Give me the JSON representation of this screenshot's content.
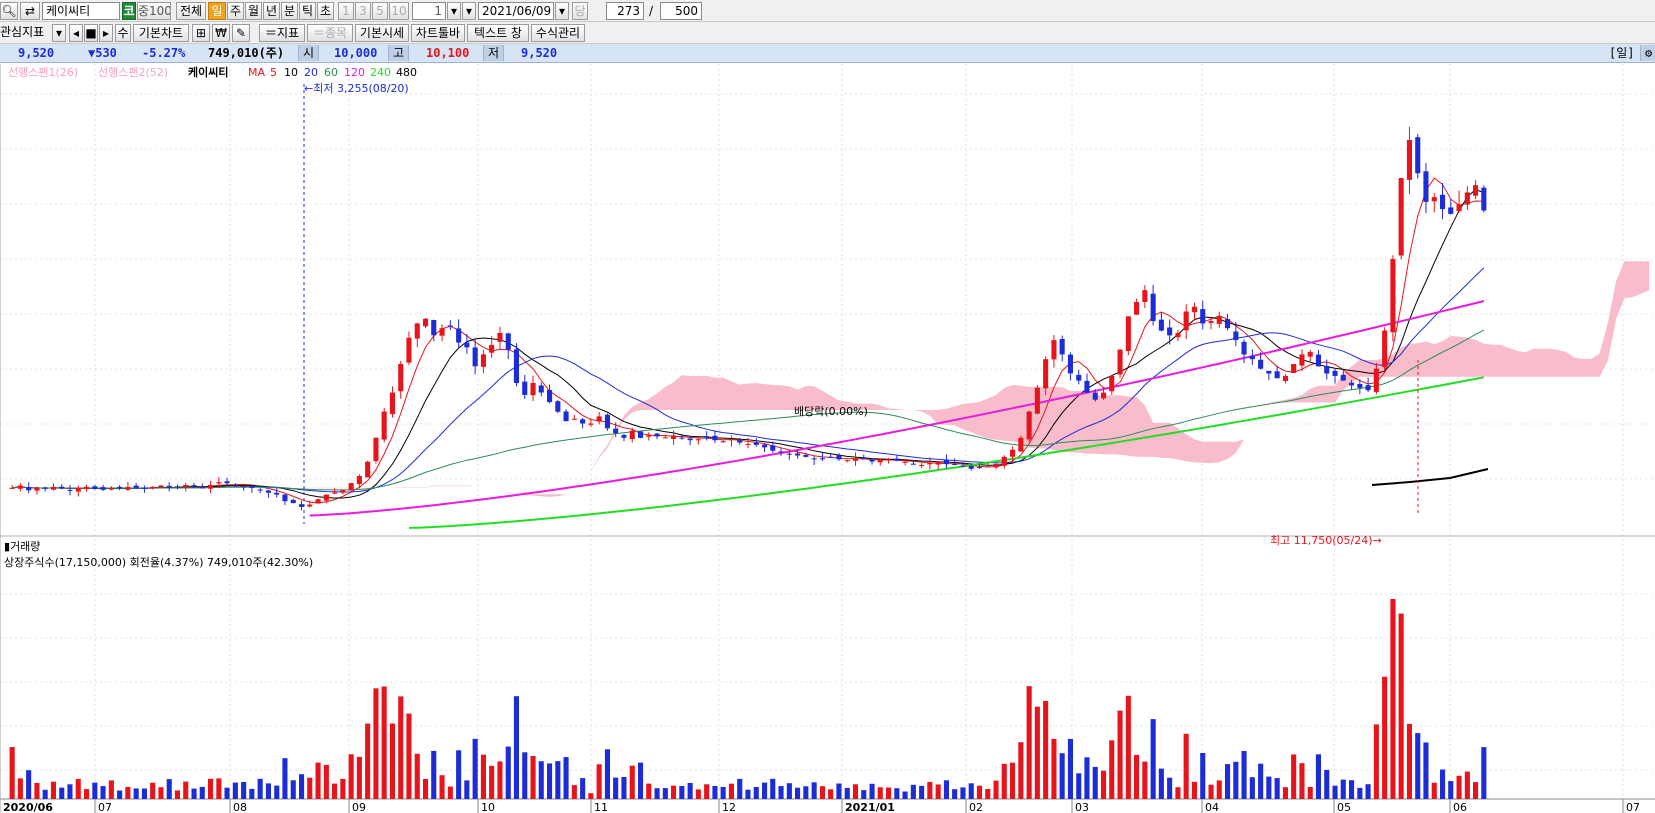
{
  "toolbar1": {
    "stock_name": "케이씨티",
    "market_badge": "코",
    "index_badge": "중100",
    "period_all": "전체",
    "period_day": "일",
    "period_week": "주",
    "period_month": "월",
    "period_year": "년",
    "period_minute": "분",
    "period_tick": "틱",
    "period_second": "초",
    "interval_1": "1",
    "interval_3": "3",
    "interval_5": "5",
    "interval_10": "10",
    "interval_value": "1",
    "date": "2021/06/09",
    "date_suffix": "당",
    "count": "273",
    "slash": "/",
    "total": "500"
  },
  "toolbar2": {
    "interest_indicator": "관심지표",
    "basic_chart": "기본차트",
    "plus_indicator": "＝지표",
    "plus_stock": "＝종목",
    "basic_quote": "기본시세",
    "chart_toolbar": "차트툴바",
    "text_toggle": "텍스트 창",
    "formula_manage": "수식관리",
    "won_icon": "₩",
    "sum_label": "수"
  },
  "pricebar": {
    "price": "9,520",
    "change": "▼530",
    "change_rate": "-5.27%",
    "volume": "749,010(주)",
    "open_label": "시",
    "open": "10,000",
    "high_label": "고",
    "high": "10,100",
    "low_label": "저",
    "low": "9,520",
    "period_tag": "[일]"
  },
  "legend": {
    "span1": "선행스팬1(26)",
    "span2": "선행스팬2(52)",
    "stock": "케이씨티",
    "ma_label": "MA",
    "ma5": "5",
    "ma10": "10",
    "ma20": "20",
    "ma60": "60",
    "ma120": "120",
    "ma240": "240",
    "ma480": "480"
  },
  "annotations": {
    "low": "←최저 3,255(08/20)",
    "high": "최고 11,750(05/24)→",
    "dividend": "배당락(0.00%)"
  },
  "volume_panel": {
    "title": "거래량",
    "info": "상장주식수(17,150,000) 회전율(4.37%) 749,010주(42.30%)"
  },
  "x_axis_labels": [
    "2020/06",
    "07",
    "08",
    "09",
    "10",
    "11",
    "12",
    "2021/01",
    "02",
    "03",
    "04",
    "05",
    "06",
    "07"
  ],
  "colors": {
    "up": "#e8141c",
    "down": "#1c2cd6",
    "cloud": "#f8b8c8",
    "ma5": "#e8141c",
    "ma10": "#000000",
    "ma20": "#1c2cd6",
    "ma60": "#2e8b57",
    "ma120": "#e81ce0",
    "ma240": "#22dd22",
    "ma480": "#000000"
  },
  "chart_data": {
    "type": "candlestick",
    "title": "케이씨티",
    "period": "daily",
    "ylim": [
      2900,
      12300
    ],
    "low_point": {
      "date": "2020/08/20",
      "value": 3255
    },
    "high_point": {
      "date": "2021/05/24",
      "value": 11750
    },
    "months": [
      "2020/06",
      "07",
      "08",
      "09",
      "10",
      "11",
      "12",
      "2021/01",
      "02",
      "03",
      "04",
      "05",
      "06"
    ],
    "close_series": [
      3700,
      3750,
      3650,
      3700,
      3680,
      3720,
      3690,
      3650,
      3700,
      3720,
      3680,
      3660,
      3700,
      3690,
      3720,
      3700,
      3680,
      3720,
      3750,
      3700,
      3720,
      3760,
      3730,
      3700,
      3760,
      3820,
      3800,
      3760,
      3720,
      3700,
      3650,
      3600,
      3560,
      3420,
      3380,
      3300,
      3350,
      3460,
      3560,
      3600,
      3650,
      3800,
      3950,
      4250,
      4750,
      5300,
      5700,
      6300,
      6850,
      7150,
      7250,
      6900,
      7050,
      7100,
      6750,
      6650,
      6250,
      6500,
      6700,
      6950,
      6600,
      5900,
      5650,
      5900,
      5700,
      5500,
      5300,
      5100,
      5150,
      5050,
      5050,
      5200,
      4950,
      4850,
      4750,
      4900,
      4750,
      4800,
      4780,
      4760,
      4800,
      4750,
      4700,
      4720,
      4750,
      4700,
      4680,
      4720,
      4650,
      4620,
      4600,
      4550,
      4480,
      4450,
      4400,
      4380,
      4350,
      4300,
      4320,
      4350,
      4300,
      4280,
      4320,
      4300,
      4250,
      4280,
      4300,
      4270,
      4250,
      4200,
      4180,
      4220,
      4250,
      4200,
      4180,
      4150,
      4100,
      4120,
      4150,
      4200,
      4350,
      4500,
      4750,
      5300,
      5800,
      6400,
      6800,
      6500,
      6100,
      5950,
      5700,
      5550,
      5700,
      6050,
      6600,
      7300,
      7600,
      7850,
      7200,
      7000,
      6900,
      6950,
      7400,
      7500,
      7150,
      7200,
      7300,
      7050,
      6800,
      6500,
      6400,
      6200,
      6100,
      6000,
      6050,
      6300,
      6500,
      6550,
      6250,
      6100,
      6050,
      5950,
      5850,
      5800,
      5750,
      6200,
      7000,
      8500,
      10200,
      11000,
      10300,
      9700,
      9800,
      9550,
      9450,
      9650,
      9900,
      10050,
      9520
    ],
    "moving_averages": [
      "5",
      "10",
      "20",
      "60",
      "120",
      "240",
      "480"
    ],
    "volume": {
      "title": "거래량",
      "listed_shares": 17150000,
      "turnover_pct": 4.37,
      "last_volume": 749010,
      "last_volume_pct": 42.3
    }
  }
}
